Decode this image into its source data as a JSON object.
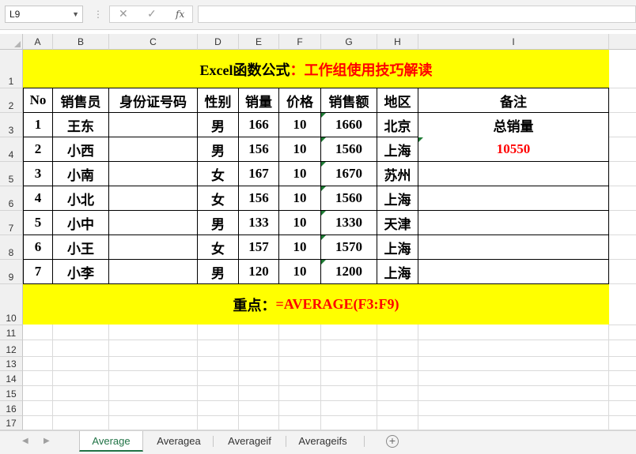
{
  "formula_bar": {
    "name_box": "L9",
    "fx_label": "fx",
    "formula": ""
  },
  "columns": [
    "A",
    "B",
    "C",
    "D",
    "E",
    "F",
    "G",
    "H",
    "I"
  ],
  "rows": [
    "1",
    "2",
    "3",
    "4",
    "5",
    "6",
    "7",
    "8",
    "9",
    "10",
    "11",
    "12",
    "13",
    "14",
    "15",
    "16",
    "17"
  ],
  "title": {
    "part1": "Excel函数公式",
    "part2": "：工作组使用技巧解读"
  },
  "table": {
    "headers": [
      "No",
      "销售员",
      "身份证号码",
      "性别",
      "销量",
      "价格",
      "销售额",
      "地区",
      "备注"
    ],
    "rows": [
      [
        "1",
        "王东",
        "",
        "男",
        "166",
        "10",
        "1660",
        "北京"
      ],
      [
        "2",
        "小西",
        "",
        "男",
        "156",
        "10",
        "1560",
        "上海"
      ],
      [
        "3",
        "小南",
        "",
        "女",
        "167",
        "10",
        "1670",
        "苏州"
      ],
      [
        "4",
        "小北",
        "",
        "女",
        "156",
        "10",
        "1560",
        "上海"
      ],
      [
        "5",
        "小中",
        "",
        "男",
        "133",
        "10",
        "1330",
        "天津"
      ],
      [
        "6",
        "小王",
        "",
        "女",
        "157",
        "10",
        "1570",
        "上海"
      ],
      [
        "7",
        "小李",
        "",
        "男",
        "120",
        "10",
        "1200",
        "上海"
      ]
    ],
    "note_label": "总销量",
    "note_value": "10550"
  },
  "footer": {
    "label": "重点：",
    "formula": "=AVERAGE(F3:F9)"
  },
  "sheet_tabs": [
    "Average",
    "Averagea",
    "Averageif",
    "Averageifs"
  ],
  "active_tab": "Average",
  "colors": {
    "highlight": "#ffff00",
    "accent_red": "#ff0000",
    "excel_green": "#217346"
  }
}
